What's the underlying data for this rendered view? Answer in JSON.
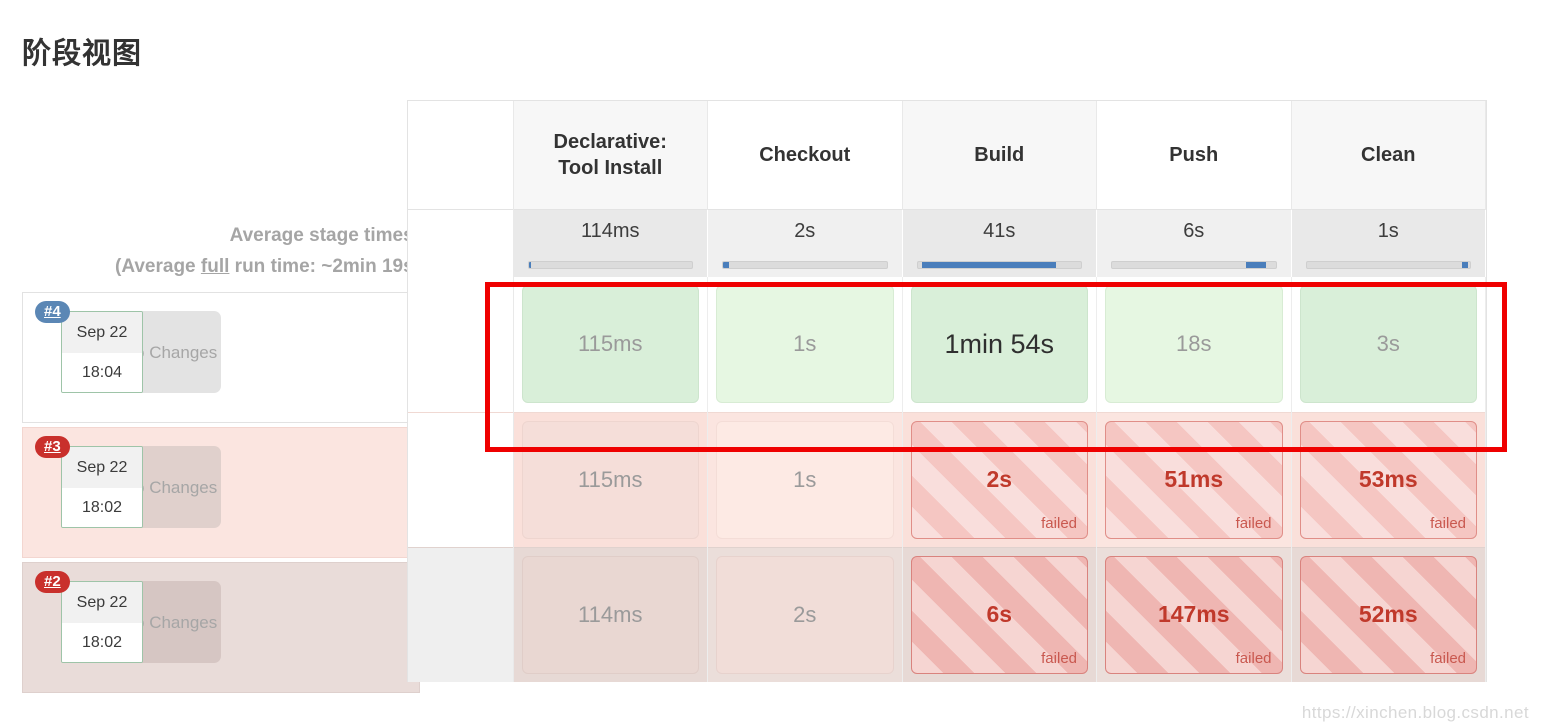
{
  "page": {
    "title": "阶段视图",
    "watermark": "https://xinchen.blog.csdn.net"
  },
  "average_summary": {
    "line1": "Average stage times:",
    "line2_pre": "(Average ",
    "line2_underlined": "full",
    "line2_post": " run time: ~2min 19s)"
  },
  "stage_table": {
    "first_column_header": "",
    "columns": [
      {
        "label": "Declarative: Tool Install",
        "label_line1": "Declarative:",
        "label_line2": "Tool Install",
        "average": "114ms",
        "bar_start_pct": 0,
        "bar_width_pct": 1.5
      },
      {
        "label": "Checkout",
        "label_line1": "Checkout",
        "label_line2": "",
        "average": "2s",
        "bar_start_pct": 0,
        "bar_width_pct": 3.5
      },
      {
        "label": "Build",
        "label_line1": "Build",
        "label_line2": "",
        "average": "41s",
        "bar_start_pct": 3,
        "bar_width_pct": 82
      },
      {
        "label": "Push",
        "label_line1": "Push",
        "label_line2": "",
        "average": "6s",
        "bar_start_pct": 82,
        "bar_width_pct": 12
      },
      {
        "label": "Clean",
        "label_line1": "Clean",
        "label_line2": "",
        "average": "1s",
        "bar_start_pct": 95,
        "bar_width_pct": 4
      }
    ],
    "rows": [
      {
        "build": "#4",
        "badge_color": "#5b87b5",
        "status": "success",
        "date": "Sep 22",
        "time": "18:04",
        "changes": "No Changes",
        "cells": [
          {
            "duration": "115ms",
            "state": "ok",
            "prominent": false,
            "failed_label": ""
          },
          {
            "duration": "1s",
            "state": "ok-light",
            "prominent": false,
            "failed_label": ""
          },
          {
            "duration": "1min 54s",
            "state": "ok",
            "prominent": true,
            "failed_label": ""
          },
          {
            "duration": "18s",
            "state": "ok-light",
            "prominent": false,
            "failed_label": ""
          },
          {
            "duration": "3s",
            "state": "ok",
            "prominent": false,
            "failed_label": ""
          }
        ]
      },
      {
        "build": "#3",
        "badge_color": "#c9302c",
        "status": "failed",
        "date": "Sep 22",
        "time": "18:02",
        "changes": "No Changes",
        "cells": [
          {
            "duration": "115ms",
            "state": "pale-a",
            "prominent": false,
            "failed_label": ""
          },
          {
            "duration": "1s",
            "state": "pale-b",
            "prominent": false,
            "failed_label": ""
          },
          {
            "duration": "2s",
            "state": "failed",
            "prominent": false,
            "failed_label": "failed"
          },
          {
            "duration": "51ms",
            "state": "failed",
            "prominent": false,
            "failed_label": "failed"
          },
          {
            "duration": "53ms",
            "state": "failed",
            "prominent": false,
            "failed_label": "failed"
          }
        ]
      },
      {
        "build": "#2",
        "badge_color": "#c9302c",
        "status": "failed",
        "date": "Sep 22",
        "time": "18:02",
        "changes": "No Changes",
        "cells": [
          {
            "duration": "114ms",
            "state": "pale-a-dark",
            "prominent": false,
            "failed_label": ""
          },
          {
            "duration": "2s",
            "state": "pale-b-dark",
            "prominent": false,
            "failed_label": ""
          },
          {
            "duration": "6s",
            "state": "failed-dark",
            "prominent": false,
            "failed_label": "failed"
          },
          {
            "duration": "147ms",
            "state": "failed-dark",
            "prominent": false,
            "failed_label": "failed"
          },
          {
            "duration": "52ms",
            "state": "failed-dark",
            "prominent": false,
            "failed_label": "failed"
          }
        ]
      }
    ]
  },
  "annotation": {
    "type": "rectangle-highlight",
    "color": "#ef0000",
    "targets_row": "#4"
  }
}
